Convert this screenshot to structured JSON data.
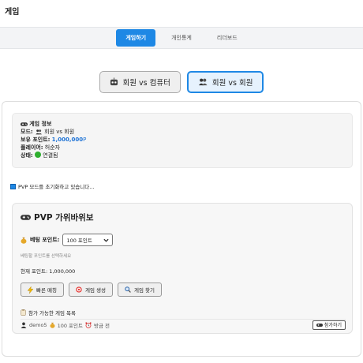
{
  "page": {
    "title": "게임"
  },
  "tabs": [
    {
      "label": "게임하기",
      "active": true
    },
    {
      "label": "개인통계",
      "active": false
    },
    {
      "label": "리더보드",
      "active": false
    }
  ],
  "modes": [
    {
      "label": "회원 vs 컴퓨터",
      "icon": "robot-icon",
      "selected": false
    },
    {
      "label": "회원 vs 회원",
      "icon": "people-icon",
      "selected": true
    }
  ],
  "info": {
    "title": "게임 정보",
    "mode_key": "모드:",
    "mode_value": "회원 vs 회원",
    "points_key": "보유 포인트:",
    "points_value": "1,000,000",
    "points_unit": "P",
    "player_key": "플레이어:",
    "player_value": "허순자",
    "status_key": "상태:",
    "status_value": "연결됨"
  },
  "init_message": "PVP 모드를 초기화하고 있습니다...",
  "game": {
    "title": "PVP 가위바위보",
    "bet_label": "베팅 포인트:",
    "bet_selected": "100 포인트",
    "bet_hint": "베팅할 포인트를 선택하세요",
    "current_points": "현재 포인트: 1,000,000",
    "buttons": {
      "quick_match": "빠른 매칭",
      "create_game": "게임 생성",
      "find_game": "게임 찾기"
    },
    "list_title": "참가 가능한 게임 목록",
    "list": [
      {
        "user": "demo5",
        "points": "100 포인트",
        "time": "방금 전",
        "join_label": "참가하기"
      }
    ]
  },
  "colors": {
    "accent": "#1e88e5",
    "status_connected": "#2eae2e",
    "points_blue": "#1e73d6"
  }
}
